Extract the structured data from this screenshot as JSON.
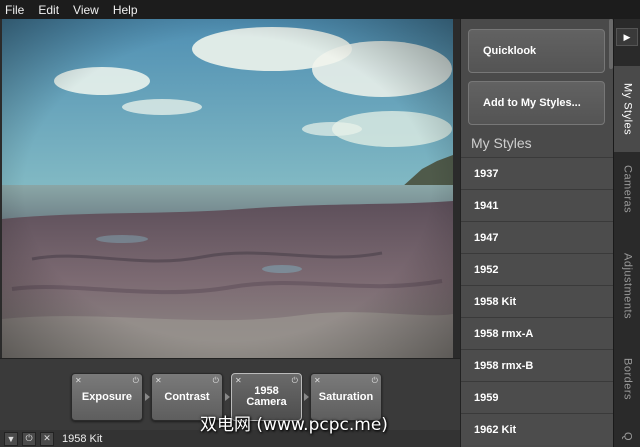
{
  "menu": [
    "File",
    "Edit",
    "View",
    "Help"
  ],
  "filters": [
    {
      "label": "Exposure"
    },
    {
      "label": "Contrast"
    },
    {
      "label": "1958 Camera"
    },
    {
      "label": "Saturation"
    }
  ],
  "status": {
    "style_name": "1958 Kit"
  },
  "sidebar": {
    "quicklook": "Quicklook",
    "add_styles": "Add to My Styles...",
    "heading": "My Styles",
    "styles": [
      "1937",
      "1941",
      "1947",
      "1952",
      "1958 Kit",
      "1958 rmx-A",
      "1958 rmx-B",
      "1959",
      "1962 Kit"
    ]
  },
  "tabs": [
    "My Styles",
    "Cameras",
    "Adjustments",
    "Borders",
    "Q"
  ],
  "watermark": "双电网 (www.pcpc.me)",
  "icons": {
    "close": "close-icon",
    "power": "power-icon",
    "collapse": "triangle-down-icon",
    "expand": "triangle-right-icon"
  },
  "colors": {
    "panel": "#4a4a4a",
    "background": "#2b2b2b",
    "menubar": "#1c1c1c"
  }
}
